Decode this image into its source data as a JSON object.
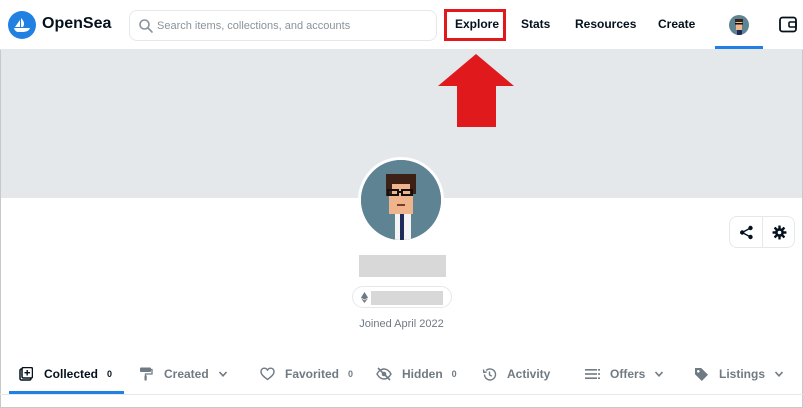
{
  "header": {
    "brand": "OpenSea",
    "search_placeholder": "Search items, collections, and accounts",
    "nav": {
      "explore": "Explore",
      "stats": "Stats",
      "resources": "Resources",
      "create": "Create"
    },
    "icons": [
      "opensea-logo-icon",
      "search-icon",
      "avatar",
      "wallet-icon"
    ]
  },
  "profile": {
    "joined": "Joined April 2022",
    "icons": [
      "ethereum-icon",
      "share-icon",
      "gear-icon"
    ]
  },
  "tabs": [
    {
      "label": "Collected",
      "count": "0",
      "icon": "collected-icon",
      "active": true
    },
    {
      "label": "Created",
      "icon": "paint-roller-icon",
      "dropdown": true
    },
    {
      "label": "Favorited",
      "count": "0",
      "icon": "heart-icon"
    },
    {
      "label": "Hidden",
      "count": "0",
      "icon": "eye-off-icon"
    },
    {
      "label": "Activity",
      "icon": "history-icon"
    },
    {
      "label": "Offers",
      "icon": "list-icon",
      "dropdown": true
    },
    {
      "label": "Listings",
      "icon": "tag-icon",
      "dropdown": true
    }
  ],
  "colors": {
    "accent": "#2081e2",
    "annotation": "#e0191c",
    "banner": "#e5e8eb",
    "text": "#04111d",
    "muted": "#707a83"
  }
}
